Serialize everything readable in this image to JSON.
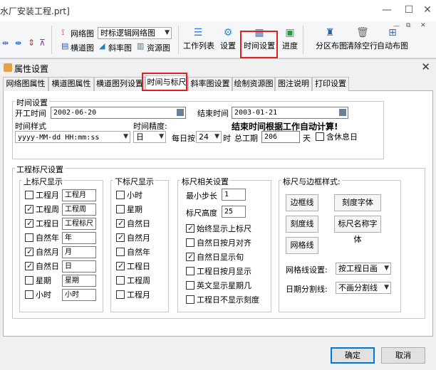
{
  "app": {
    "title": "水厂安装工程.prt]"
  },
  "toolbar": {
    "network_label": "网络图",
    "network_combo": "时标逻辑网络图",
    "horizontal_label": "横道图",
    "oblique_label": "斜率图",
    "resource_label": "资源图",
    "worklist_label": "工作列表",
    "settings_label": "设置",
    "timesetting_label": "时间设置",
    "progress_label": "进度",
    "partition_label": "分区布图",
    "clear_label": "清除空行",
    "auto_label": "自动布图"
  },
  "dialog": {
    "title": "属性设置",
    "tabs": [
      "网络图属性",
      "横道图属性",
      "横道图列设置",
      "时间与标尺",
      "斜率图设置",
      "绘制资源图",
      "图注说明",
      "打印设置"
    ],
    "active_tab": 3,
    "time_settings": {
      "title": "时间设置",
      "start_label": "开工时间",
      "start_value": "2002-06-20",
      "end_label": "结束时间",
      "end_value": "2003-01-21",
      "format_label": "时间样式",
      "format_value": "yyyy-MM-dd HH:mm:ss",
      "precision_label": "时间精度:",
      "precision_value": "日",
      "daily_label": "每日按",
      "daily_value": "24",
      "hour_unit": "时",
      "total_label": "总工期",
      "total_value": "206",
      "day_unit": "天",
      "include_rest": "含休息日",
      "auto_notice": "结束时间根据工作自动计算!"
    },
    "ruler": {
      "title": "工程标尺设置",
      "upper": {
        "title": "上标尺显示",
        "items": [
          {
            "label": "工程月",
            "checked": false,
            "text": "工程月"
          },
          {
            "label": "工程周",
            "checked": true,
            "text": "工程周"
          },
          {
            "label": "工程日",
            "checked": true,
            "text": "工程标尺"
          },
          {
            "label": "自然年",
            "checked": false,
            "text": "年"
          },
          {
            "label": "自然月",
            "checked": true,
            "text": "月"
          },
          {
            "label": "自然日",
            "checked": true,
            "text": "日"
          },
          {
            "label": "星期",
            "checked": false,
            "text": "星期"
          },
          {
            "label": "小时",
            "checked": false,
            "text": "小时"
          }
        ]
      },
      "lower": {
        "title": "下标尺显示",
        "items": [
          {
            "label": "小时",
            "checked": false
          },
          {
            "label": "星期",
            "checked": false
          },
          {
            "label": "自然日",
            "checked": true
          },
          {
            "label": "自然月",
            "checked": true
          },
          {
            "label": "自然年",
            "checked": false
          },
          {
            "label": "工程日",
            "checked": true
          },
          {
            "label": "工程周",
            "checked": false
          },
          {
            "label": "工程月",
            "checked": false
          }
        ]
      },
      "related": {
        "title": "标尺相关设置",
        "min_step_label": "最小步长",
        "min_step_value": "1",
        "height_label": "标尺高度",
        "height_value": "25",
        "options": [
          {
            "label": "始终显示上标尺",
            "checked": true
          },
          {
            "label": "自然日按月对齐",
            "checked": false
          },
          {
            "label": "自然日显示旬",
            "checked": true
          },
          {
            "label": "工程日按月显示",
            "checked": false
          },
          {
            "label": "英文显示星期几",
            "checked": false
          },
          {
            "label": "工程日不显示刻度",
            "checked": false
          }
        ]
      },
      "style": {
        "title": "标尺与边框样式:",
        "border_btn": "边框线",
        "scale_font_btn": "刻度字体",
        "scale_line_btn": "刻度线",
        "ruler_name_font_btn": "标尺名称字体",
        "grid_btn": "网格线",
        "grid_label": "网格线设置:",
        "grid_value": "按工程日画",
        "date_label": "日期分割线:",
        "date_value": "不画分割线"
      }
    },
    "ok": "确定",
    "cancel": "取消"
  },
  "colors": {
    "highlight": "#e02020",
    "accent": "#0078d7"
  }
}
